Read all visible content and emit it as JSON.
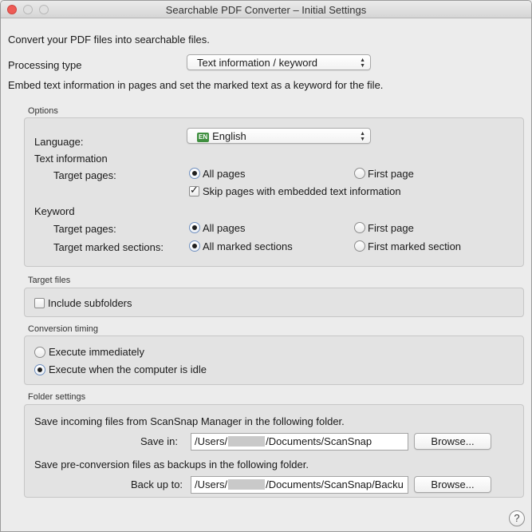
{
  "window": {
    "title": "Searchable PDF Converter – Initial Settings"
  },
  "intro": "Convert your PDF files into searchable files.",
  "processing": {
    "label": "Processing type",
    "value": "Text information / keyword",
    "description": "Embed text information in pages and set the marked text as a keyword for the file."
  },
  "options": {
    "header": "Options",
    "language_label": "Language:",
    "language_badge": "EN",
    "language_value": "English",
    "text_info": {
      "heading": "Text information",
      "target_pages_label": "Target pages:",
      "opt_all": "All pages",
      "opt_first": "First page",
      "selected": "All pages",
      "skip_label": "Skip pages with embedded text information",
      "skip_checked": true
    },
    "keyword": {
      "heading": "Keyword",
      "target_pages_label": "Target pages:",
      "opt_all": "All pages",
      "opt_first": "First page",
      "pages_selected": "All pages",
      "sections_label": "Target marked sections:",
      "opt_all_sections": "All marked sections",
      "opt_first_section": "First marked section",
      "sections_selected": "All marked sections"
    }
  },
  "target_files": {
    "header": "Target files",
    "include_subfolders": "Include subfolders",
    "include_checked": false
  },
  "conversion_timing": {
    "header": "Conversion timing",
    "opt_immediate": "Execute immediately",
    "opt_idle": "Execute when the computer is idle",
    "selected": "Execute when the computer is idle"
  },
  "folder_settings": {
    "header": "Folder settings",
    "save_desc": "Save incoming files from ScanSnap Manager in the following folder.",
    "save_label": "Save in:",
    "save_prefix": "/Users/",
    "save_suffix": "/Documents/ScanSnap",
    "backup_desc": "Save pre-conversion files as backups in the following folder.",
    "backup_label": "Back up to:",
    "backup_prefix": "/Users/",
    "backup_suffix": "/Documents/ScanSnap/Backu",
    "browse_label": "Browse..."
  },
  "help": {
    "label": "?"
  },
  "icons": {
    "close": "close-icon",
    "minimize": "minimize-icon",
    "zoom": "zoom-icon",
    "popup_arrows": "up-down-arrows-icon",
    "help": "help-icon"
  },
  "colors": {
    "close_button": "#ee5b55",
    "window_background": "#ececec",
    "group_background": "#e3e3e3",
    "language_badge": "#3f8f3f"
  }
}
